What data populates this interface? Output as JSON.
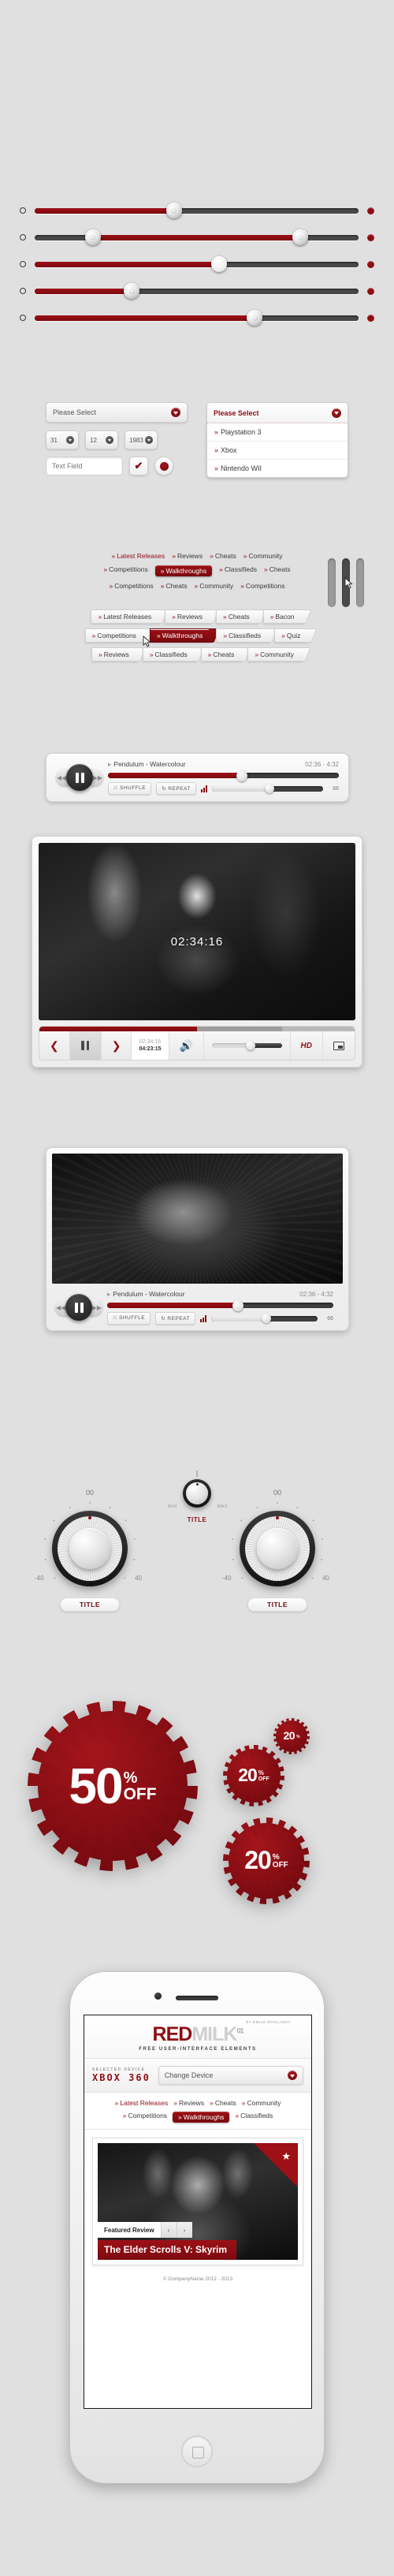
{
  "sliders": [
    {
      "fill_side": "left",
      "fill_pct": 43,
      "knob_pct": 43,
      "knob_style": "textured",
      "second_knob": null
    },
    {
      "fill_side": "middle",
      "fill_start": 18,
      "fill_end": 82,
      "knob_pct": 18,
      "knob_style": "textured",
      "second_knob": 82
    },
    {
      "fill_side": "left",
      "fill_pct": 57,
      "knob_pct": 57,
      "knob_style": "plain",
      "second_knob": null
    },
    {
      "fill_side": "left",
      "fill_pct": 30,
      "knob_pct": 30,
      "knob_style": "textured",
      "second_knob": null
    },
    {
      "fill_side": "left",
      "fill_pct": 68,
      "knob_pct": 68,
      "knob_style": "textured",
      "second_knob": null
    }
  ],
  "forms": {
    "select_placeholder": "Please Select",
    "select_open_label": "Please Select",
    "dropdown_items": [
      "Playstation 3",
      "Xbox",
      "Nintendo WII"
    ],
    "date_day": "31",
    "date_month": "12",
    "date_year": "1983",
    "text_field_value": "Text Field",
    "checkbox_glyph": "✔",
    "radio_checked": true
  },
  "nav": {
    "row1": [
      {
        "label": "Latest Releases",
        "state": "active"
      },
      {
        "label": "Reviews",
        "state": "normal"
      },
      {
        "label": "Cheats",
        "state": "normal"
      },
      {
        "label": "Community",
        "state": "normal"
      }
    ],
    "row2": [
      {
        "label": "Competitions",
        "state": "normal"
      },
      {
        "label": "Walkthroughs",
        "state": "pill"
      },
      {
        "label": "Classifieds",
        "state": "normal"
      },
      {
        "label": "Cheats",
        "state": "normal"
      }
    ],
    "row3": [
      {
        "label": "Competitions",
        "state": "normal"
      },
      {
        "label": "Cheats",
        "state": "normal"
      },
      {
        "label": "Community",
        "state": "normal"
      },
      {
        "label": "Competitions",
        "state": "normal"
      }
    ],
    "arrow_row1": [
      {
        "label": "Latest Releases",
        "on": false
      },
      {
        "label": "Reviews",
        "on": false
      },
      {
        "label": "Cheats",
        "on": false
      },
      {
        "label": "Bacon",
        "on": false
      }
    ],
    "arrow_row2": [
      {
        "label": "Competitions",
        "on": false
      },
      {
        "label": "Walkthroughs",
        "on": true
      },
      {
        "label": "Classifieds",
        "on": false
      },
      {
        "label": "Quiz",
        "on": false
      }
    ],
    "arrow_row3": [
      {
        "label": "Reviews",
        "on": false
      },
      {
        "label": "Classifieds",
        "on": false
      },
      {
        "label": "Cheats",
        "on": false
      },
      {
        "label": "Community",
        "on": false
      }
    ]
  },
  "audio_player": {
    "track_title": "Pendulum - Watercolour",
    "time": "02:36 - 4:32",
    "progress_pct": 58,
    "shuffle_label": "SHUFFLE",
    "repeat_label": "REPEAT",
    "volume_value": "66",
    "volume_pct": 52
  },
  "video_player": {
    "overlay_time": "02:34:16",
    "current_time": "02:34:16",
    "total_time": "04:23:15",
    "hd_label": "HD",
    "progress_pct": 50,
    "buffered_pct": 27,
    "volume_pct": 55
  },
  "knobs": {
    "left": {
      "value": "00",
      "min": "-40",
      "max": "40",
      "title": "TITLE"
    },
    "right": {
      "value": "00",
      "min": "-40",
      "max": "40",
      "title": "TITLE"
    },
    "center": {
      "min": "MIN",
      "max": "MAX",
      "title": "TITLE"
    }
  },
  "badges": [
    {
      "number": "50",
      "percent": "%",
      "off": "OFF",
      "size": "large"
    },
    {
      "number": "20",
      "percent": "%",
      "off": "OFF",
      "size": "medium"
    },
    {
      "number": "20",
      "percent": "%",
      "off": "",
      "size": "small"
    },
    {
      "number": "20",
      "percent": "%",
      "off": "OFF",
      "size": "medium2"
    }
  ],
  "phone": {
    "byline": "BY EMILE ROHLANDT",
    "logo_red": "RED",
    "logo_milk": "MILK",
    "logo_num": "01",
    "tagline": "FREE USER-INTERFACE ELEMENTS",
    "device_label": "SELECTED DEVICE",
    "device_name": "XBOX 360",
    "change_device": "Change Device",
    "nav_row1": [
      {
        "label": "Latest Releases",
        "state": "active"
      },
      {
        "label": "Reviews",
        "state": "normal"
      },
      {
        "label": "Cheats",
        "state": "normal"
      },
      {
        "label": "Community",
        "state": "normal"
      }
    ],
    "nav_row2": [
      {
        "label": "Competitions",
        "state": "normal"
      },
      {
        "label": "Walkthroughs",
        "state": "pill"
      },
      {
        "label": "Classifieds",
        "state": "normal"
      }
    ],
    "featured_label": "Featured Review",
    "featured_title": "The Elder Scrolls V: Skyrim",
    "prev_glyph": "‹",
    "next_glyph": "›",
    "star_glyph": "★",
    "footer": "© CompanyName 2012 - 2013"
  },
  "colors": {
    "accent_red": "#8d0d13",
    "dark_red": "#7a0b11",
    "page_bg": "#e0e0e0"
  }
}
